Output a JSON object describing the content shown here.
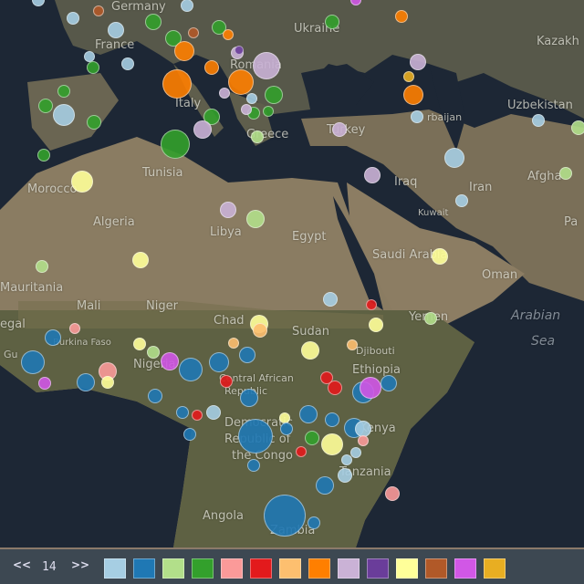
{
  "labels": {
    "germany": "Germany",
    "france": "France",
    "ukraine": "Ukraine",
    "kazakh": "Kazakh",
    "romania": "Romania",
    "italy": "Italy",
    "greece": "Greece",
    "turkey": "Turkey",
    "uzbekistan": "Uzbekistan",
    "azerbaijan": "rbaijan",
    "tunisia": "Tunisia",
    "morocco": "Morocco",
    "iraq": "Iraq",
    "iran": "Iran",
    "afghanistan": "Afgha",
    "algeria": "Algeria",
    "libya": "Libya",
    "egypt": "Egypt",
    "kuwait": "Kuwait",
    "saudi": "Saudi Arabia",
    "oman": "Oman",
    "mauritania": "Mauritania",
    "mali": "Mali",
    "niger": "Niger",
    "chad": "Chad",
    "sudan": "Sudan",
    "yemen": "Yemen",
    "arabian1": "Arabian",
    "arabian2": "Sea",
    "burkina": "Burkina Faso",
    "nigeria": "Nigeria",
    "djibouti": "Djibouti",
    "ethiopia": "Ethiopia",
    "car": "Central African",
    "car2": "Republic",
    "drc1": "Democratic",
    "drc2": "Republic of",
    "drc3": "the Congo",
    "kenya": "Kenya",
    "tanzania": "Tanzania",
    "angola": "Angola",
    "zambia": "Zambia",
    "senegal": "egal",
    "guinea": "Gu",
    "pakistan": "Pa"
  },
  "controls": {
    "prev": "<<",
    "next": ">>",
    "page": "14"
  },
  "palette": [
    "#a6cee3",
    "#1f78b4",
    "#b2df8a",
    "#33a02c",
    "#fb9a99",
    "#e31a1c",
    "#fdbf6f",
    "#ff7f00",
    "#cab2d6",
    "#6a3d9a",
    "#ffff99",
    "#b15928",
    "#d157e6",
    "#e8ae22"
  ]
}
